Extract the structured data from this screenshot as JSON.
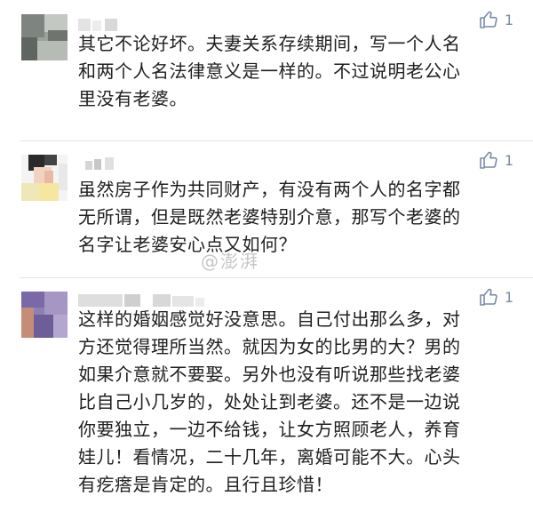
{
  "comments": [
    {
      "likes": "1",
      "lines": [
        "其它不论好坏。夫妻关系存续期间，写一个人名",
        "和两个人名法律意义是一样的。不过说明老公心",
        "里没有老婆。"
      ]
    },
    {
      "likes": "1",
      "lines": [
        "虽然房子作为共同财产，有没有两个人的名字都",
        "无所谓，但是既然老婆特别介意，那写个老婆的",
        "名字让老婆安心点又如何？"
      ]
    },
    {
      "likes": "1",
      "lines": [
        "这样的婚姻感觉好没意思。自己付出那么多，对",
        "方还觉得理所当然。就因为女的比男的大？男的",
        "如果介意就不要娶。另外也没有听说那些找老婆",
        "比自己小几岁的，处处让到老婆。还不是一边说",
        "你要独立，一边不给钱，让女方照顾老人，养育",
        "娃儿！看情况，二十几年，离婚可能不大。心头",
        "有疙瘩是肯定的。且行且珍惜！"
      ]
    }
  ],
  "watermark": "@澎湃",
  "colors": {
    "like_icon": "#7a8aa6",
    "text": "#202020",
    "divider": "#e6e6e6"
  }
}
